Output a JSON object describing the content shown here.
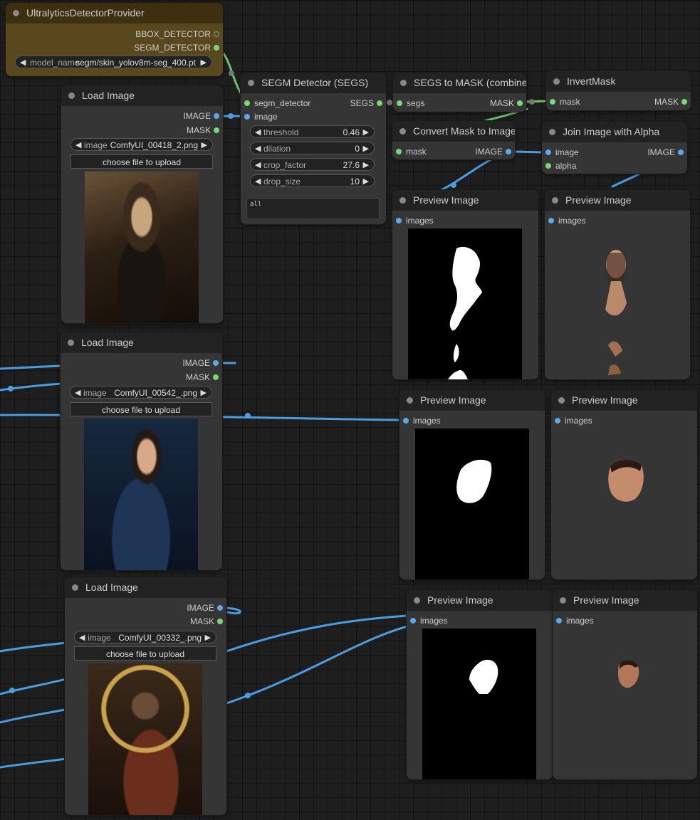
{
  "colors": {
    "image_wire": "#4a9de0",
    "mask_wire": "#6cc36c",
    "canvas": "#1e1e1e",
    "node": "#353535",
    "provider_node": "#59481e"
  },
  "provider": {
    "title": "UltralyticsDetectorProvider",
    "outputs": [
      "BBOX_DETECTOR",
      "SEGM_DETECTOR"
    ],
    "model_label": "model_name",
    "model_value": "segm/skin_yolov8m-seg_400.pt"
  },
  "load_images": [
    {
      "title": "Load Image",
      "outputs": [
        "IMAGE",
        "MASK"
      ],
      "image_label": "image",
      "image_value": "ComfyUI_00418_2.png",
      "upload": "choose file to upload",
      "photo_icon": "woman-black-dress-photo"
    },
    {
      "title": "Load Image",
      "outputs": [
        "IMAGE",
        "MASK"
      ],
      "image_label": "image",
      "image_value": "ComfyUI_00542_.png",
      "upload": "choose file to upload",
      "photo_icon": "man-blue-suit-photo"
    },
    {
      "title": "Load Image",
      "outputs": [
        "IMAGE",
        "MASK"
      ],
      "image_label": "image",
      "image_value": "ComfyUI_00332_.png",
      "upload": "choose file to upload",
      "photo_icon": "woman-brown-robe-photo"
    }
  ],
  "segm": {
    "title": "SEGM Detector (SEGS)",
    "inputs": [
      "segm_detector",
      "image"
    ],
    "output": "SEGS",
    "threshold_label": "threshold",
    "threshold_value": "0.46",
    "dilation_label": "dilation",
    "dilation_value": "0",
    "crop_label": "crop_factor",
    "crop_value": "27.6",
    "drop_label": "drop_size",
    "drop_value": "10",
    "labels_text": "all"
  },
  "segs_to_mask": {
    "title": "SEGS to MASK (combined)",
    "input": "segs",
    "output": "MASK"
  },
  "invert_mask": {
    "title": "InvertMask",
    "input": "mask",
    "output": "MASK"
  },
  "convert_mask": {
    "title": "Convert Mask to Image",
    "input": "mask",
    "output": "IMAGE"
  },
  "join_alpha": {
    "title": "Join Image with Alpha",
    "inputs": [
      "image",
      "alpha"
    ],
    "output": "IMAGE"
  },
  "previews": [
    {
      "title": "Preview Image",
      "input": "images"
    },
    {
      "title": "Preview Image",
      "input": "images"
    },
    {
      "title": "Preview Image",
      "input": "images"
    },
    {
      "title": "Preview Image",
      "input": "images"
    },
    {
      "title": "Preview Image",
      "input": "images"
    },
    {
      "title": "Preview Image",
      "input": "images"
    }
  ]
}
